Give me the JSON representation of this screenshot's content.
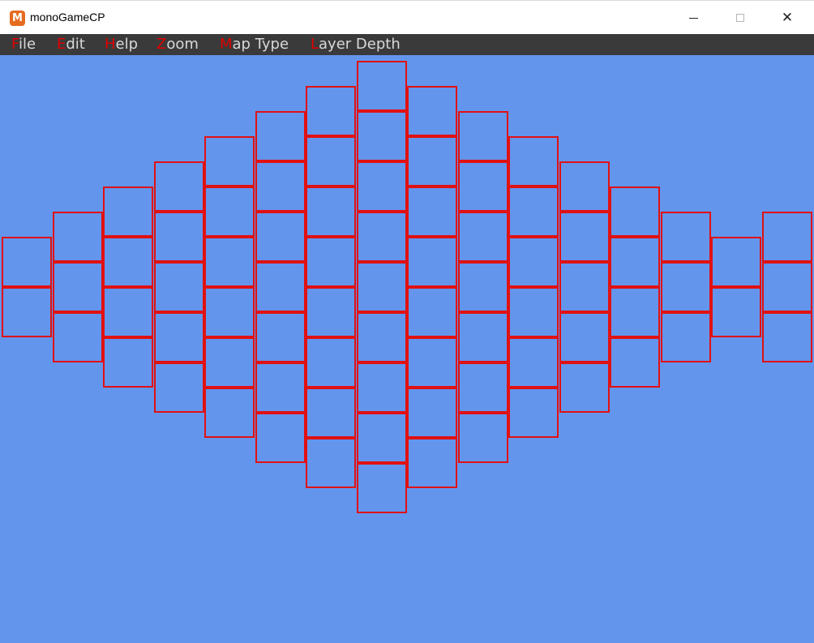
{
  "window": {
    "title": "monoGameCP",
    "app_icon": "monogame-logo-icon",
    "minimize": "minimize-icon",
    "maximize": "maximize-icon",
    "close": "close-icon"
  },
  "menu": {
    "items": [
      {
        "accel": "F",
        "rest": "ile"
      },
      {
        "accel": "E",
        "rest": "dit"
      },
      {
        "accel": "H",
        "rest": "elp"
      },
      {
        "accel": "Z",
        "rest": "oom"
      },
      {
        "accel": "M",
        "rest": "ap Type"
      },
      {
        "accel": "L",
        "rest": "ayer Depth"
      }
    ]
  },
  "colors": {
    "background": "#6495ED",
    "tile_border": "#E11111",
    "menu_background": "#3A3A3A",
    "menu_accel": "#E00000"
  },
  "map": {
    "columns_tiles": [
      2,
      3,
      4,
      5,
      6,
      7,
      8,
      9,
      8,
      7,
      6,
      5,
      4,
      3,
      2,
      3
    ]
  }
}
